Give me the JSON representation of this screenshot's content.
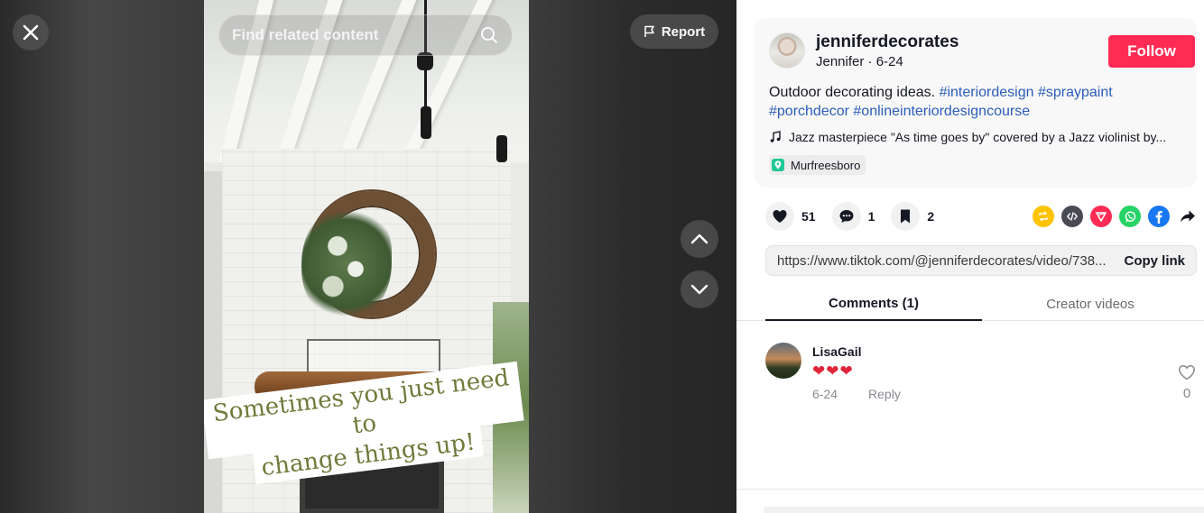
{
  "viewer": {
    "search_placeholder": "Find related content",
    "report_label": "Report",
    "caption_lines": [
      "Sometimes you just need to",
      "change things up!"
    ]
  },
  "post": {
    "username": "jenniferdecorates",
    "display_name": "Jennifer",
    "separator": " · ",
    "date": "6-24",
    "follow_label": "Follow",
    "description": "Outdoor decorating ideas. ",
    "hashtags": [
      "#interiordesign",
      "#spraypaint",
      "#porchdecor",
      "#onlineinteriordesigncourse"
    ],
    "music": "Jazz masterpiece \"As time goes by\" covered by a Jazz violinist by...",
    "location": "Murfreesboro"
  },
  "actions": {
    "likes": "51",
    "comments": "1",
    "saves": "2"
  },
  "share": {
    "link_url": "https://www.tiktok.com/@jenniferdecorates/video/738...",
    "copy_label": "Copy link",
    "icons": [
      {
        "name": "repost-icon",
        "color": "#ffc300"
      },
      {
        "name": "embed-icon",
        "color": "#4a4a55"
      },
      {
        "name": "send-icon",
        "color": "#fe2c55"
      },
      {
        "name": "whatsapp-icon",
        "color": "#25d366"
      },
      {
        "name": "facebook-icon",
        "color": "#1877f2"
      },
      {
        "name": "share-arrow-icon",
        "color": "#161823"
      }
    ]
  },
  "tabs": {
    "comments_label": "Comments (1)",
    "creator_label": "Creator videos"
  },
  "comments": [
    {
      "user": "LisaGail",
      "text": "❤❤❤",
      "date": "6-24",
      "reply_label": "Reply",
      "like_count": "0"
    }
  ],
  "colors": {
    "accent": "#fe2c55",
    "hashtag": "#2b5db9"
  }
}
